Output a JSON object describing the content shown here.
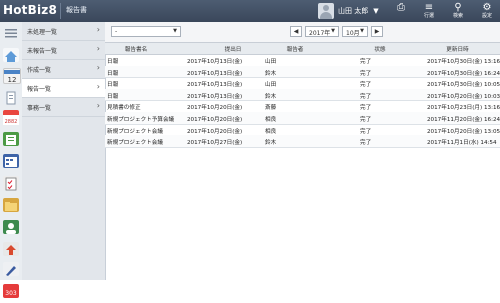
{
  "app": {
    "logo": "HotBiz8",
    "page_title": "報告書"
  },
  "header": {
    "user_name": "山田 太郎",
    "icons": [
      {
        "name": "print-icon",
        "label": ""
      },
      {
        "name": "filter-icon",
        "label": "行選"
      },
      {
        "name": "search-icon",
        "label": "検索"
      },
      {
        "name": "gear-icon",
        "label": "設定"
      }
    ]
  },
  "nav": {
    "items": [
      {
        "label": "未処理一覧"
      },
      {
        "label": "未報告一覧"
      },
      {
        "label": "作成一覧"
      },
      {
        "label": "報告一覧"
      },
      {
        "label": "事務一覧"
      }
    ]
  },
  "toolbar": {
    "filter_value": "-",
    "year": "2017年",
    "month": "10月"
  },
  "table": {
    "columns": [
      "報告書名",
      "提出日",
      "報告者",
      "状態",
      "更新日時"
    ],
    "rows": [
      [
        "日報",
        "2017年10月13日(金)",
        "山田",
        "完了",
        "2017年10月30日(金) 13:16"
      ],
      [
        "日報",
        "2017年10月13日(金)",
        "鈴木",
        "完了",
        "2017年10月30日(金) 16:24"
      ],
      [
        "日報",
        "2017年10月13日(金)",
        "山田",
        "完了",
        "2017年10月30日(金) 10:05"
      ],
      [
        "日報",
        "2017年10月13日(金)",
        "鈴木",
        "完了",
        "2017年10月20日(金) 10:03"
      ],
      [
        "見積書の修正",
        "2017年10月20日(金)",
        "斎藤",
        "完了",
        "2017年10月23日(月) 13:16"
      ],
      [
        "新規プロジェクト予算会議",
        "2017年10月20日(金)",
        "相良",
        "完了",
        "2017年11月20日(金) 16:24"
      ],
      [
        "新規プロジェクト会議",
        "2017年10月20日(金)",
        "相良",
        "完了",
        "2017年10月20日(金) 13:05"
      ],
      [
        "新規プロジェクト会議",
        "2017年10月27日(金)",
        "鈴木",
        "完了",
        "2017年11月1日(水) 14:54"
      ]
    ]
  },
  "colors": {
    "header_bg": "#3f4d61",
    "nav_bg": "#e2e6eb",
    "nav_active_bg": "#ffffff"
  }
}
